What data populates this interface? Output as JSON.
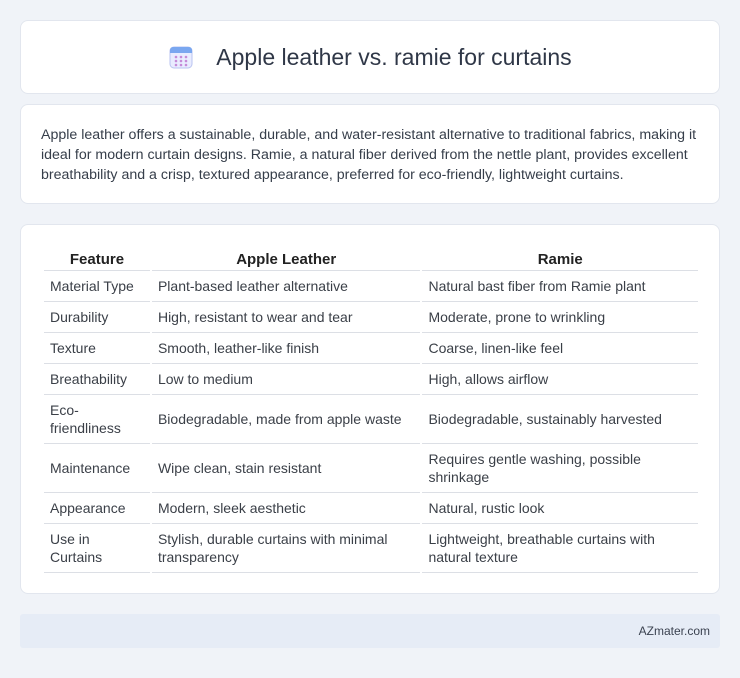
{
  "header": {
    "title": "Apple leather vs. ramie for curtains",
    "icon": "calendar-icon",
    "icon_colors": {
      "top": "#7aa7f0",
      "body": "#e9ecff",
      "dots": "#c58ad8"
    }
  },
  "intro": {
    "text": "Apple leather offers a sustainable, durable, and water-resistant alternative to traditional fabrics, making it ideal for modern curtain designs. Ramie, a natural fiber derived from the nettle plant, provides excellent breathability and a crisp, textured appearance, preferred for eco-friendly, lightweight curtains."
  },
  "table": {
    "headers": [
      "Feature",
      "Apple Leather",
      "Ramie"
    ],
    "rows": [
      {
        "feature": "Material Type",
        "apple": "Plant-based leather alternative",
        "ramie": "Natural bast fiber from Ramie plant"
      },
      {
        "feature": "Durability",
        "apple": "High, resistant to wear and tear",
        "ramie": "Moderate, prone to wrinkling"
      },
      {
        "feature": "Texture",
        "apple": "Smooth, leather-like finish",
        "ramie": "Coarse, linen-like feel"
      },
      {
        "feature": "Breathability",
        "apple": "Low to medium",
        "ramie": "High, allows airflow"
      },
      {
        "feature": "Eco-friendliness",
        "apple": "Biodegradable, made from apple waste",
        "ramie": "Biodegradable, sustainably harvested"
      },
      {
        "feature": "Maintenance",
        "apple": "Wipe clean, stain resistant",
        "ramie": "Requires gentle washing, possible shrinkage"
      },
      {
        "feature": "Appearance",
        "apple": "Modern, sleek aesthetic",
        "ramie": "Natural, rustic look"
      },
      {
        "feature": "Use in Curtains",
        "apple": "Stylish, durable curtains with minimal transparency",
        "ramie": "Lightweight, breathable curtains with natural texture"
      }
    ]
  },
  "footer": {
    "text": "AZmater.com"
  }
}
